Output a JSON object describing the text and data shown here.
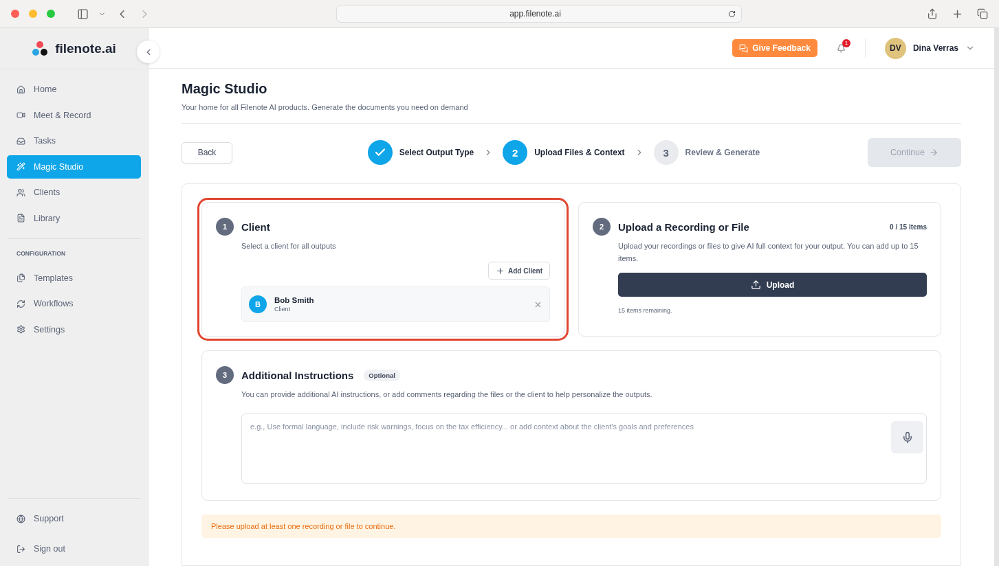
{
  "browser": {
    "url": "app.filenote.ai"
  },
  "sidebar": {
    "logo": "filenote.ai",
    "items": [
      {
        "label": "Home",
        "selected": false
      },
      {
        "label": "Meet & Record",
        "selected": false
      },
      {
        "label": "Tasks",
        "selected": false
      },
      {
        "label": "Magic Studio",
        "selected": true
      },
      {
        "label": "Clients",
        "selected": false
      },
      {
        "label": "Library",
        "selected": false
      }
    ],
    "section_label": "CONFIGURATION",
    "config_items": [
      {
        "label": "Templates",
        "selected": false
      },
      {
        "label": "Workflows",
        "selected": false
      },
      {
        "label": "Settings",
        "selected": false
      }
    ],
    "footer_items": [
      {
        "label": "Support"
      },
      {
        "label": "Sign out"
      }
    ]
  },
  "header": {
    "feedback_button": "Give Feedback",
    "notification_count": "1",
    "user": {
      "initials": "DV",
      "name": "Dina Verras"
    }
  },
  "page": {
    "title": "Magic Studio",
    "subtitle": "Your home for all Filenote AI products. Generate the documents you need on demand"
  },
  "wizard": {
    "back_button": "Back",
    "continue_button": {
      "label": "Continue",
      "disabled": true
    },
    "steps": [
      {
        "label": "Select Output Type",
        "completed": true,
        "selected": false
      },
      {
        "number": "2",
        "label": "Upload Files & Context",
        "completed": false,
        "selected": true
      },
      {
        "number": "3",
        "label": "Review & Generate",
        "completed": false,
        "selected": false
      }
    ]
  },
  "client_section": {
    "number": "1",
    "title": "Client",
    "description": "Select a client for all outputs",
    "highlighted": true,
    "add_button": "Add Client",
    "selected_client": {
      "initial": "B",
      "name": "Bob Smith",
      "role": "Client"
    }
  },
  "upload_section": {
    "number": "2",
    "title": "Upload a Recording or File",
    "count": "0 / 15 items",
    "description": "Upload your recordings or files to give AI full context for your output. You can add up to 15 items.",
    "upload_button": "Upload",
    "remaining": "15 items remaining."
  },
  "instructions_section": {
    "number": "3",
    "title": "Additional Instructions",
    "badge": "Optional",
    "description": "You can provide additional AI instructions, or add comments regarding the files or the client to help personalize the outputs.",
    "placeholder": "e.g., Use formal language, include risk warnings, focus on the tax efficiency... or add context about the client's goals and preferences"
  },
  "warning": "Please upload at least one recording or file to continue."
}
